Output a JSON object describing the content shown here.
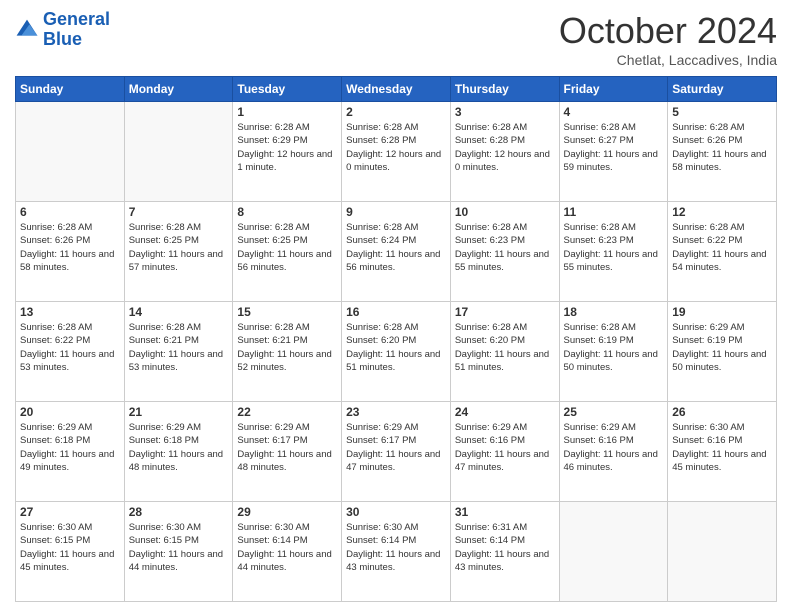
{
  "logo": {
    "line1": "General",
    "line2": "Blue"
  },
  "title": "October 2024",
  "location": "Chetlat, Laccadives, India",
  "headers": [
    "Sunday",
    "Monday",
    "Tuesday",
    "Wednesday",
    "Thursday",
    "Friday",
    "Saturday"
  ],
  "weeks": [
    [
      {
        "day": "",
        "info": ""
      },
      {
        "day": "",
        "info": ""
      },
      {
        "day": "1",
        "info": "Sunrise: 6:28 AM\nSunset: 6:29 PM\nDaylight: 12 hours\nand 1 minute."
      },
      {
        "day": "2",
        "info": "Sunrise: 6:28 AM\nSunset: 6:28 PM\nDaylight: 12 hours\nand 0 minutes."
      },
      {
        "day": "3",
        "info": "Sunrise: 6:28 AM\nSunset: 6:28 PM\nDaylight: 12 hours\nand 0 minutes."
      },
      {
        "day": "4",
        "info": "Sunrise: 6:28 AM\nSunset: 6:27 PM\nDaylight: 11 hours\nand 59 minutes."
      },
      {
        "day": "5",
        "info": "Sunrise: 6:28 AM\nSunset: 6:26 PM\nDaylight: 11 hours\nand 58 minutes."
      }
    ],
    [
      {
        "day": "6",
        "info": "Sunrise: 6:28 AM\nSunset: 6:26 PM\nDaylight: 11 hours\nand 58 minutes."
      },
      {
        "day": "7",
        "info": "Sunrise: 6:28 AM\nSunset: 6:25 PM\nDaylight: 11 hours\nand 57 minutes."
      },
      {
        "day": "8",
        "info": "Sunrise: 6:28 AM\nSunset: 6:25 PM\nDaylight: 11 hours\nand 56 minutes."
      },
      {
        "day": "9",
        "info": "Sunrise: 6:28 AM\nSunset: 6:24 PM\nDaylight: 11 hours\nand 56 minutes."
      },
      {
        "day": "10",
        "info": "Sunrise: 6:28 AM\nSunset: 6:23 PM\nDaylight: 11 hours\nand 55 minutes."
      },
      {
        "day": "11",
        "info": "Sunrise: 6:28 AM\nSunset: 6:23 PM\nDaylight: 11 hours\nand 55 minutes."
      },
      {
        "day": "12",
        "info": "Sunrise: 6:28 AM\nSunset: 6:22 PM\nDaylight: 11 hours\nand 54 minutes."
      }
    ],
    [
      {
        "day": "13",
        "info": "Sunrise: 6:28 AM\nSunset: 6:22 PM\nDaylight: 11 hours\nand 53 minutes."
      },
      {
        "day": "14",
        "info": "Sunrise: 6:28 AM\nSunset: 6:21 PM\nDaylight: 11 hours\nand 53 minutes."
      },
      {
        "day": "15",
        "info": "Sunrise: 6:28 AM\nSunset: 6:21 PM\nDaylight: 11 hours\nand 52 minutes."
      },
      {
        "day": "16",
        "info": "Sunrise: 6:28 AM\nSunset: 6:20 PM\nDaylight: 11 hours\nand 51 minutes."
      },
      {
        "day": "17",
        "info": "Sunrise: 6:28 AM\nSunset: 6:20 PM\nDaylight: 11 hours\nand 51 minutes."
      },
      {
        "day": "18",
        "info": "Sunrise: 6:28 AM\nSunset: 6:19 PM\nDaylight: 11 hours\nand 50 minutes."
      },
      {
        "day": "19",
        "info": "Sunrise: 6:29 AM\nSunset: 6:19 PM\nDaylight: 11 hours\nand 50 minutes."
      }
    ],
    [
      {
        "day": "20",
        "info": "Sunrise: 6:29 AM\nSunset: 6:18 PM\nDaylight: 11 hours\nand 49 minutes."
      },
      {
        "day": "21",
        "info": "Sunrise: 6:29 AM\nSunset: 6:18 PM\nDaylight: 11 hours\nand 48 minutes."
      },
      {
        "day": "22",
        "info": "Sunrise: 6:29 AM\nSunset: 6:17 PM\nDaylight: 11 hours\nand 48 minutes."
      },
      {
        "day": "23",
        "info": "Sunrise: 6:29 AM\nSunset: 6:17 PM\nDaylight: 11 hours\nand 47 minutes."
      },
      {
        "day": "24",
        "info": "Sunrise: 6:29 AM\nSunset: 6:16 PM\nDaylight: 11 hours\nand 47 minutes."
      },
      {
        "day": "25",
        "info": "Sunrise: 6:29 AM\nSunset: 6:16 PM\nDaylight: 11 hours\nand 46 minutes."
      },
      {
        "day": "26",
        "info": "Sunrise: 6:30 AM\nSunset: 6:16 PM\nDaylight: 11 hours\nand 45 minutes."
      }
    ],
    [
      {
        "day": "27",
        "info": "Sunrise: 6:30 AM\nSunset: 6:15 PM\nDaylight: 11 hours\nand 45 minutes."
      },
      {
        "day": "28",
        "info": "Sunrise: 6:30 AM\nSunset: 6:15 PM\nDaylight: 11 hours\nand 44 minutes."
      },
      {
        "day": "29",
        "info": "Sunrise: 6:30 AM\nSunset: 6:14 PM\nDaylight: 11 hours\nand 44 minutes."
      },
      {
        "day": "30",
        "info": "Sunrise: 6:30 AM\nSunset: 6:14 PM\nDaylight: 11 hours\nand 43 minutes."
      },
      {
        "day": "31",
        "info": "Sunrise: 6:31 AM\nSunset: 6:14 PM\nDaylight: 11 hours\nand 43 minutes."
      },
      {
        "day": "",
        "info": ""
      },
      {
        "day": "",
        "info": ""
      }
    ]
  ]
}
